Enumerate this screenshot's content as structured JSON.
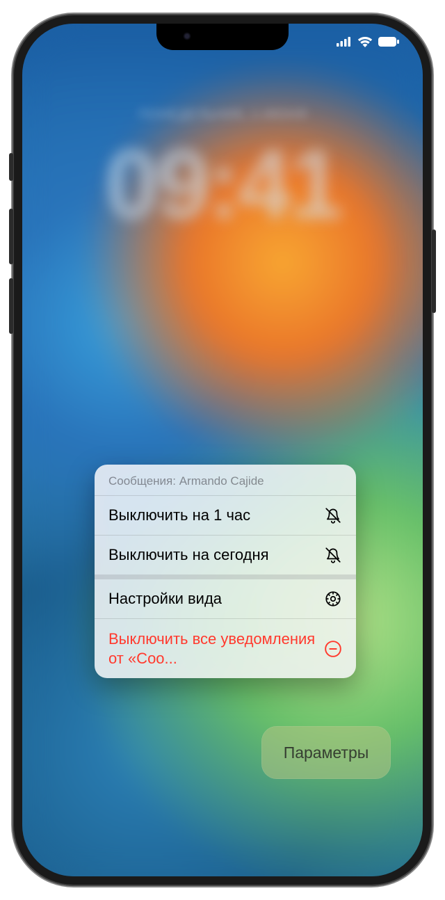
{
  "lock_screen": {
    "blurred_time": "09:41",
    "blurred_date": "ПОНЕДЕЛЬНИК, 1 ИЮНЯ"
  },
  "menu": {
    "header": "Сообщения: Armando Cajide",
    "items": [
      {
        "label": "Выключить на 1 час",
        "icon": "bell-slash-icon",
        "destructive": false
      },
      {
        "label": "Выключить на сегодня",
        "icon": "bell-slash-icon",
        "destructive": false
      },
      {
        "label": "Настройки вида",
        "icon": "gear-icon",
        "destructive": false
      },
      {
        "label": "Выключить все уведомления от «Соо...",
        "icon": "minus-circle-icon",
        "destructive": true
      }
    ]
  },
  "options_pill": {
    "label": "Параметры"
  }
}
